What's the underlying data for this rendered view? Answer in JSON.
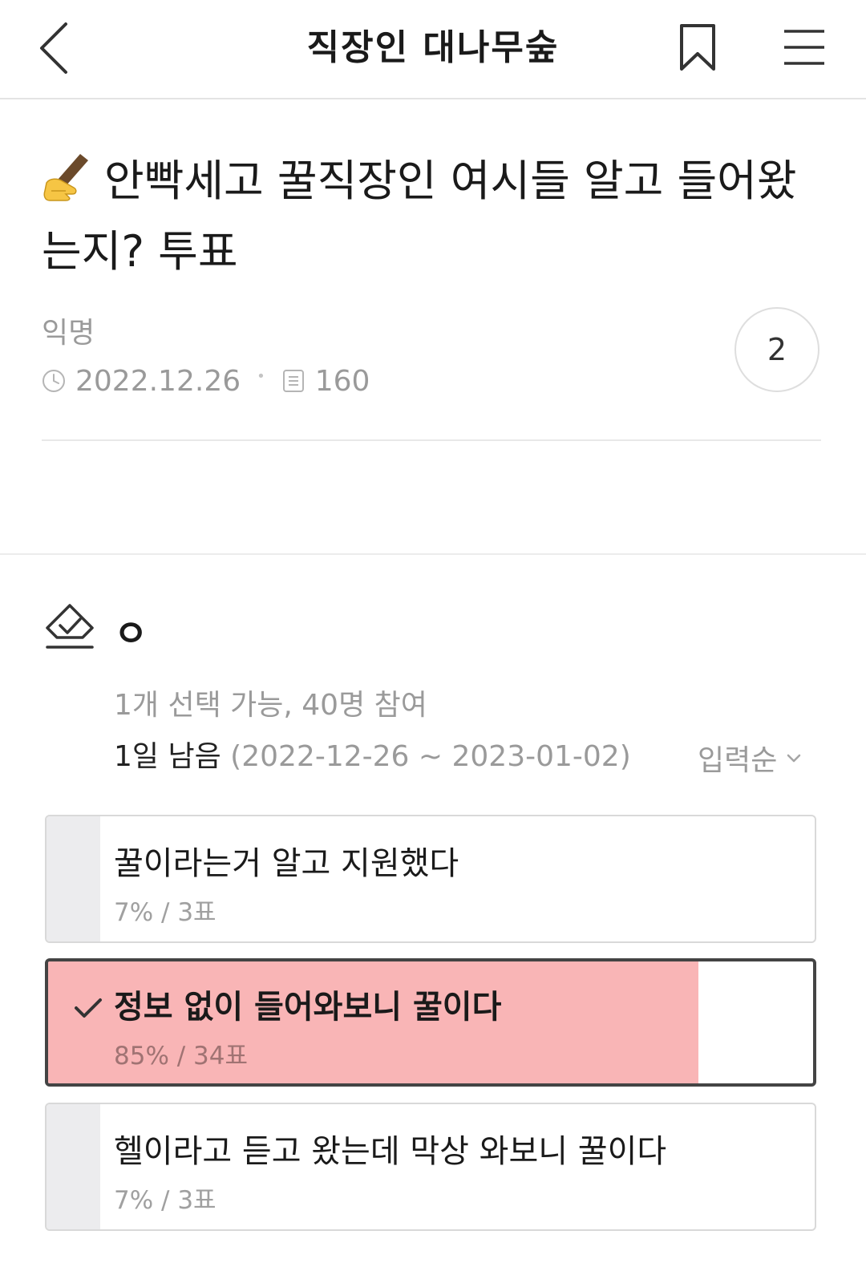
{
  "header": {
    "title": "직장인 대나무숲"
  },
  "post": {
    "title": "안빡세고 꿀직장인 여시들 알고 들어왔는지? 투표",
    "author": "익명",
    "date": "2022.12.26",
    "views": "160",
    "comment_count": "2"
  },
  "poll": {
    "title": "ㅇ",
    "info": "1개 선택 가능, 40명 참여",
    "remaining": "1일 남음",
    "period": "(2022-12-26 ~ 2023-01-02)",
    "sort_label": "입력순",
    "options": [
      {
        "label": "꿀이라는거 알고 지원했다",
        "result": "7% / 3표",
        "percent": 7,
        "selected": false
      },
      {
        "label": "정보 없이 들어와보니 꿀이다",
        "result": "85% / 34표",
        "percent": 85,
        "selected": true
      },
      {
        "label": "헬이라고 듣고 왔는데 막상 와보니 꿀이다",
        "result": "7% / 3표",
        "percent": 7,
        "selected": false
      }
    ]
  },
  "colors": {
    "selected_fill": "#f9b5b6",
    "unselected_fill": "#ececee",
    "selected_border": "#444444"
  }
}
